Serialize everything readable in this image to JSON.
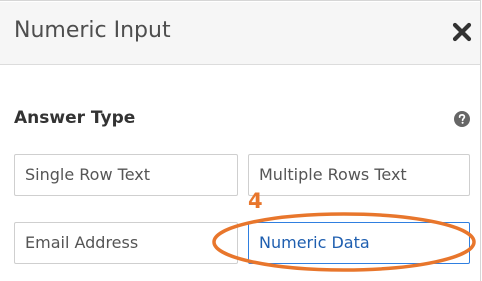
{
  "dialog": {
    "title": "Numeric Input",
    "close_icon": "close-x-icon"
  },
  "answer_type": {
    "label": "Answer Type",
    "help_icon": "question-circle-icon",
    "options": [
      {
        "label": "Single Row Text",
        "selected": false
      },
      {
        "label": "Multiple Rows Text",
        "selected": false
      },
      {
        "label": "Email Address",
        "selected": false
      },
      {
        "label": "Numeric Data",
        "selected": true
      }
    ]
  },
  "annotation": {
    "step_number": "4",
    "color": "#e8762c"
  },
  "colors": {
    "accent": "#2f7fe0",
    "header_bg": "#f6f6f6",
    "annotation": "#e8762c"
  }
}
